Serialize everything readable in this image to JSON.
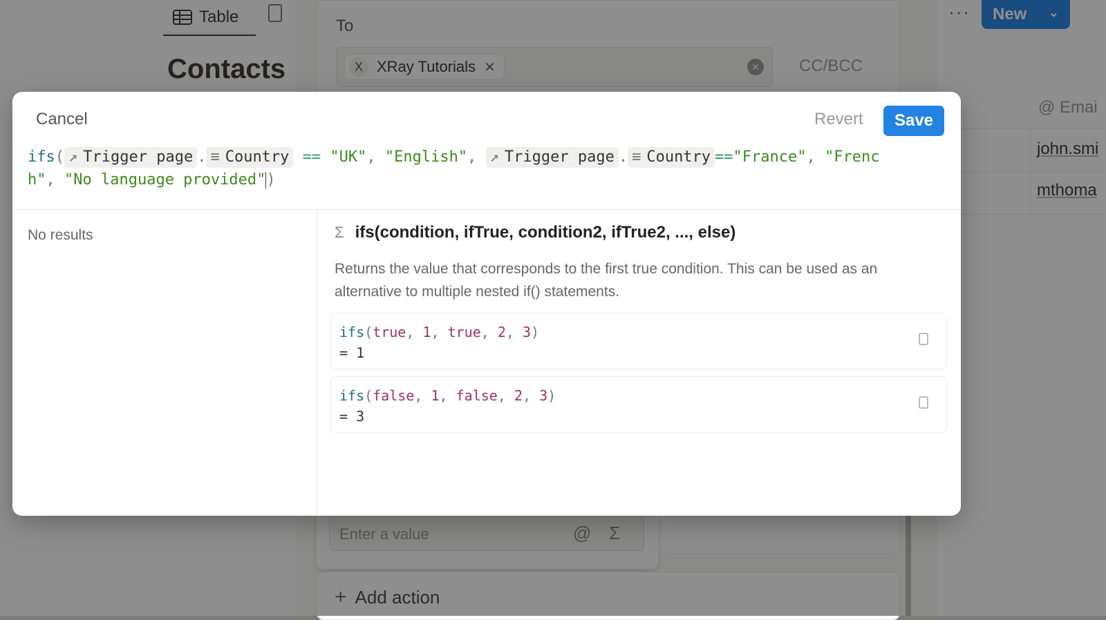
{
  "background": {
    "view_tab_label": "Table",
    "database_title": "Contacts",
    "more_label": "···",
    "new_button_label": "New",
    "new_button_chevron": "⌄",
    "email_column_header": "@ Emai",
    "email_cells": [
      "john.smi",
      "mthoma"
    ],
    "to_label": "To",
    "recipient_chip": {
      "avatar": "X",
      "label": "XRay Tutorials",
      "remove": "✕"
    },
    "cc_bcc_label": "CC/BCC",
    "value_input_placeholder": "Enter a value",
    "value_input_at": "@",
    "value_input_sigma": "Σ",
    "add_action_label": "Add action",
    "add_action_plus": "+"
  },
  "modal": {
    "cancel_label": "Cancel",
    "revert_label": "Revert",
    "save_label": "Save",
    "formula": {
      "fn": "ifs",
      "open": "(",
      "close": ")",
      "token_trigger_icon": "↗",
      "token_trigger": "Trigger page",
      "token_prop_icon": "≡",
      "token_prop": "Country",
      "dot": ".",
      "eq_spaced": "==",
      "eq": "==",
      "comma": ",",
      "s_uk": "\"UK\"",
      "s_english": "\"English\"",
      "s_france": "\"France\"",
      "s_french_1": "\"Frenc",
      "s_french_2": "h\"",
      "s_nolang": "\"No language provided\""
    },
    "no_results": "No results",
    "doc": {
      "sigma": "Σ",
      "signature": "ifs(condition, ifTrue, condition2, ifTrue2, ..., else)",
      "description": "Returns the value that corresponds to the first true condition. This can be used as an alternative to multiple nested if() statements."
    },
    "examples": [
      {
        "fn": "ifs",
        "a": "true",
        "b": "1",
        "c": "true",
        "d": "2",
        "e": "3",
        "result": "= 1"
      },
      {
        "fn": "ifs",
        "a": "false",
        "b": "1",
        "c": "false",
        "d": "2",
        "e": "3",
        "result": "= 3"
      }
    ]
  }
}
